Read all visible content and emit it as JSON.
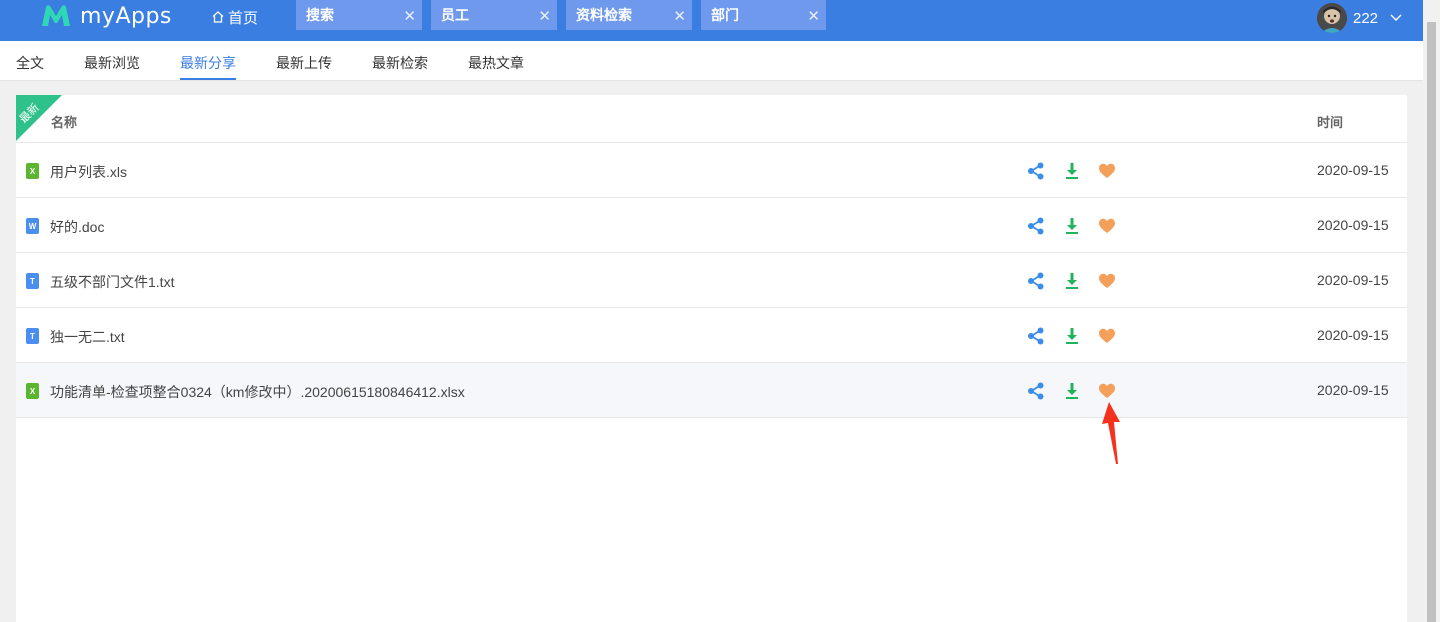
{
  "app": {
    "name": "myApps"
  },
  "topbar": {
    "home_label": "首页",
    "tabs": [
      {
        "label": "搜索",
        "close": "✕"
      },
      {
        "label": "员工",
        "close": "✕"
      },
      {
        "label": "资料检索",
        "close": "✕"
      },
      {
        "label": "部门",
        "close": "✕"
      }
    ],
    "user": {
      "name": "222"
    }
  },
  "subnav": {
    "items": [
      "全文",
      "最新浏览",
      "最新分享",
      "最新上传",
      "最新检索",
      "最热文章"
    ],
    "active": "最新分享"
  },
  "panel": {
    "ribbon": "最新",
    "columns": {
      "name": "名称",
      "time": "时间"
    },
    "rows": [
      {
        "icon": "X",
        "type": "xls",
        "name": "用户列表.xls",
        "date": "2020-09-15"
      },
      {
        "icon": "W",
        "type": "doc",
        "name": "好的.doc",
        "date": "2020-09-15"
      },
      {
        "icon": "T",
        "type": "txt",
        "name": "五级不部门文件1.txt",
        "date": "2020-09-15"
      },
      {
        "icon": "T",
        "type": "txt",
        "name": "独一无二.txt",
        "date": "2020-09-15"
      },
      {
        "icon": "X",
        "type": "xls",
        "name": "功能清单-检查项整合0324（km修改中）.20200615180846412.xlsx",
        "date": "2020-09-15"
      }
    ],
    "actions": [
      "share-icon",
      "download-icon",
      "favorite-heart-icon"
    ]
  },
  "colors": {
    "header": "#3b7ee1",
    "tab": "#6f99ec",
    "share": "#3b8ee8",
    "download": "#22b45c",
    "heart": "#f4a05a",
    "ribbon": "#2ec28a",
    "annotation_arrow": "#f5321e"
  }
}
